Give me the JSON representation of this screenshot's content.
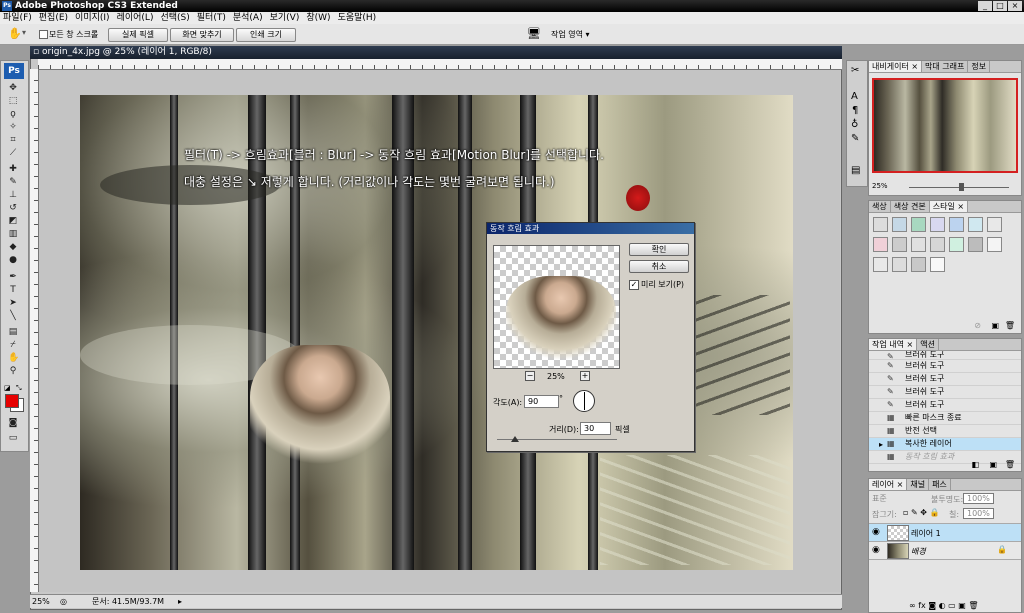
{
  "app": {
    "window_title": "Adobe Photoshop CS3 Extended",
    "logo": "Ps",
    "window_buttons": [
      "_",
      "□",
      "×"
    ]
  },
  "menu": [
    "파일(F)",
    "편집(E)",
    "이미지(I)",
    "레이어(L)",
    "선택(S)",
    "필터(T)",
    "분석(A)",
    "보기(V)",
    "창(W)",
    "도움말(H)"
  ],
  "options_bar": {
    "scroll_all": "모든 창 스크롤",
    "actual_pixels": "실제 픽셀",
    "fit_screen": "화면 맞추기",
    "print_size": "인쇄 크기",
    "workspace": "작업 영역 ▾"
  },
  "document": {
    "title": "origin_4x.jpg @ 25% (레이어 1, RGB/8)",
    "zoom": "25%",
    "doc_size": "문서: 41.5M/93.7M"
  },
  "instructions": {
    "line1": "필터(T) -> 흐림효과[블러 : Blur] -> 동작 흐림 효과[Motion Blur]를 선택합니다.",
    "line2": "대충 설정은 ↘ 저렇게 합니다. (거리값이나 각도는 몇번 굴려보면 됩니다.)"
  },
  "dialog": {
    "title": "동작 흐림 효과",
    "ok": "확인",
    "cancel": "취소",
    "preview_label": "미리 보기(P)",
    "preview_checked": true,
    "zoom": "25%",
    "angle_label": "각도(A):",
    "angle_value": "90",
    "angle_unit": "°",
    "distance_label": "거리(D):",
    "distance_value": "30",
    "distance_unit": "픽셀",
    "zoom_out": "−",
    "zoom_in": "+"
  },
  "panels": {
    "navigator": {
      "tabs": [
        "내비게이터 ×",
        "막대 그래프",
        "정보"
      ],
      "zoom": "25%"
    },
    "styles": {
      "tabs": [
        "색상",
        "색상 견본",
        "스타일 ×"
      ]
    },
    "history": {
      "tabs": [
        "작업 내역 ×",
        "액션"
      ],
      "items": [
        "브러쉬 도구",
        "브러쉬 도구",
        "브러쉬 도구",
        "브러쉬 도구",
        "브러쉬 도구",
        "빠른 마스크 종료",
        "반전 선택",
        "복사한 레이어",
        "동작 흐림 효과"
      ]
    },
    "layers": {
      "tabs": [
        "레이어 ×",
        "채널",
        "패스"
      ],
      "blend_mode": "표준",
      "opacity_label": "불투명도:",
      "opacity": "100%",
      "lock_label": "잠그기:",
      "fill_label": "칠:",
      "fill": "100%",
      "layers": [
        {
          "name": "레이어 1",
          "selected": true
        },
        {
          "name": "배경",
          "selected": false
        }
      ]
    }
  },
  "colors": {
    "foreground": "#e60000",
    "background": "#ffffff",
    "selection": "#bde0f6"
  }
}
